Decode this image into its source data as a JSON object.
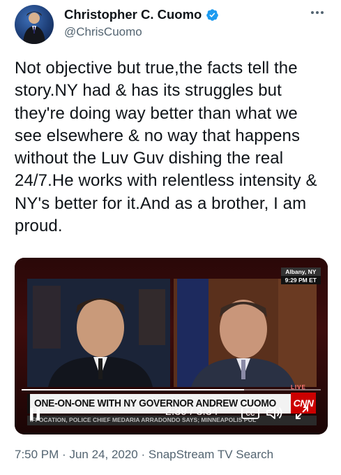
{
  "author": {
    "display_name": "Christopher C. Cuomo",
    "handle": "@ChrisCuomo"
  },
  "tweet": {
    "text": "Not objective but true,the facts tell the story.NY had & has its struggles but they're doing way better than what we see elsewhere & no way that happens without the Luv Guv dishing the real 24/7.He works with relentless intensity & NY's better for it.And as a brother, I am proud."
  },
  "media": {
    "broadcast": {
      "location": "Albany, NY",
      "local_time": "9:29 PM ET",
      "headline": "ONE-ON-ONE WITH NY GOVERNOR ANDREW CUOMO",
      "network": "CNN",
      "live_label": "LIVE",
      "ticker": "IFFOCATION, POLICE CHIEF MEDARIA ARRADONDO SAYS; MINNEAPOLIS POL"
    },
    "player": {
      "timecode": "2:39 / 3:34",
      "progress": 0.743,
      "cc_label": "CC"
    }
  },
  "meta": {
    "time": "7:50 PM",
    "separator": "·",
    "date": "Jun 24, 2020",
    "source": "SnapStream TV Search"
  },
  "colors": {
    "verified_blue": "#1d9bf0",
    "secondary_text": "#536471",
    "cnn_red": "#cc0000"
  },
  "icons": [
    "verified-badge-icon",
    "more-options-icon",
    "pause-icon",
    "closed-captions-icon",
    "volume-icon",
    "fullscreen-icon"
  ]
}
